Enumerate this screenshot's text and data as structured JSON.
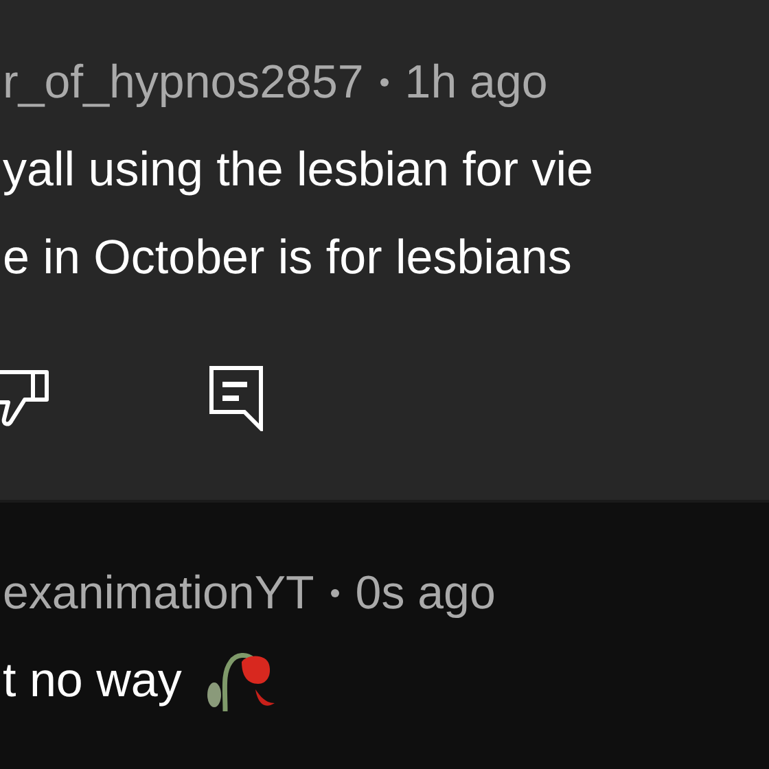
{
  "comments": [
    {
      "author": "r_of_hypnos2857",
      "time": "1h ago",
      "lines": [
        "yall using the lesbian for vie",
        "e in October is for lesbians"
      ],
      "actions": true,
      "emoji_after": false
    },
    {
      "author": "exanimationYT",
      "time": "0s ago",
      "lines": [
        "t no way"
      ],
      "actions": false,
      "emoji_after": true
    }
  ]
}
